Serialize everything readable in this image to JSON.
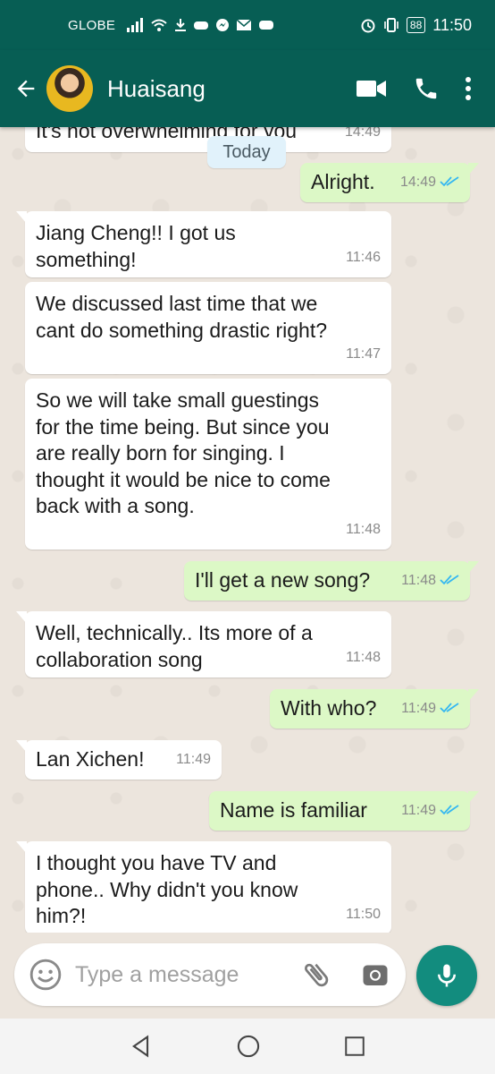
{
  "status_bar": {
    "carrier": "GLOBE",
    "battery": "88",
    "time": "11:50"
  },
  "header": {
    "contact_name": "Huaisang"
  },
  "chat": {
    "date_divider": "Today",
    "top_partial": {
      "text": "It's not overwhelming for you",
      "time": "14:49"
    },
    "messages": [
      {
        "dir": "out",
        "text": "Alright.",
        "time": "14:49"
      },
      {
        "dir": "in",
        "text": "Jiang Cheng!! I got us something!",
        "time": "11:46"
      },
      {
        "dir": "in",
        "text": "We discussed last time that we cant do something drastic right?",
        "time": "11:47"
      },
      {
        "dir": "in",
        "text": "So we will take small guestings for the time being. But since you are really born for singing. I thought it would be nice to come back with a song.",
        "time": "11:48"
      },
      {
        "dir": "out",
        "text": "I'll get a new song?",
        "time": "11:48"
      },
      {
        "dir": "in",
        "text": "Well, technically.. Its more of a collaboration song",
        "time": "11:48"
      },
      {
        "dir": "out",
        "text": "With who?",
        "time": "11:49"
      },
      {
        "dir": "in",
        "text": "Lan Xichen!",
        "time": "11:49"
      },
      {
        "dir": "out",
        "text": "Name is familiar",
        "time": "11:49"
      },
      {
        "dir": "in",
        "text": "I thought you have TV and phone.. Why didn't you know him?!",
        "time": "11:50"
      }
    ]
  },
  "composer": {
    "placeholder": "Type a message"
  },
  "colors": {
    "header": "#075e54",
    "outgoing_bubble": "#dcf8c6",
    "incoming_bubble": "#ffffff",
    "mic_button": "#128c7e",
    "read_ticks": "#34b7f1"
  }
}
